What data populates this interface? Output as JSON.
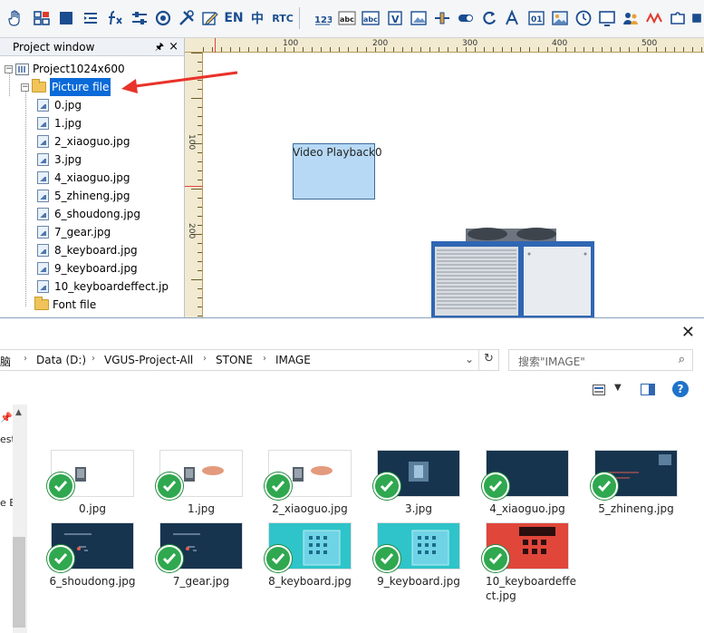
{
  "toolbar": {
    "buttons": [
      {
        "icon": "hand-icon"
      },
      {
        "icon": "grid-icon"
      },
      {
        "icon": "square-icon"
      },
      {
        "icon": "align-icon"
      },
      {
        "icon": "function-icon"
      },
      {
        "icon": "sliders-icon"
      },
      {
        "icon": "circle-arrow-icon"
      },
      {
        "icon": "tools-icon"
      },
      {
        "icon": "edit-icon"
      },
      {
        "label": "EN"
      },
      {
        "label": "中"
      },
      {
        "label": "RTC"
      },
      {
        "icon": "text-123-icon"
      },
      {
        "icon": "text-abc-icon"
      },
      {
        "icon": "text-abc-box-icon"
      },
      {
        "icon": "variable-icon"
      },
      {
        "icon": "image-icon"
      },
      {
        "icon": "slider-icon"
      },
      {
        "icon": "switch-icon"
      },
      {
        "icon": "rotate-icon"
      },
      {
        "icon": "font-icon"
      },
      {
        "icon": "counter-icon"
      },
      {
        "icon": "picture-icon"
      },
      {
        "icon": "clock-icon"
      },
      {
        "icon": "display-icon"
      },
      {
        "icon": "curve-icon"
      },
      {
        "icon": "users-icon"
      },
      {
        "icon": "wave-icon"
      },
      {
        "icon": "puzzle-icon"
      },
      {
        "icon": "chip-icon"
      }
    ],
    "labels": {
      "en": "EN",
      "zh": "中",
      "rtc": "RTC"
    }
  },
  "project_window": {
    "title": "Project window",
    "root": "Project1024x600",
    "picture_folder": "Picture file",
    "files": [
      "0.jpg",
      "1.jpg",
      "2_xiaoguo.jpg",
      "3.jpg",
      "4_xiaoguo.jpg",
      "5_zhineng.jpg",
      "6_shoudong.jpg",
      "7_gear.jpg",
      "8_keyboard.jpg",
      "9_keyboard.jpg",
      "10_keyboardeffect.jp"
    ],
    "font_folder": "Font file"
  },
  "canvas": {
    "ruler_h": [
      "100",
      "200",
      "300",
      "400",
      "500"
    ],
    "ruler_v": [
      "100",
      "200"
    ],
    "widget_label": "Video Playback0"
  },
  "explorer": {
    "breadcrumb": [
      "脑",
      "Data (D:)",
      "VGUS-Project-All",
      "STONE",
      "IMAGE"
    ],
    "search_placeholder": "搜索\"IMAGE\"",
    "side_labels": [
      "estp",
      "e ES"
    ],
    "files": [
      {
        "name": "0.jpg",
        "theme": "white"
      },
      {
        "name": "1.jpg",
        "theme": "white"
      },
      {
        "name": "2_xiaoguo.jpg",
        "theme": "white"
      },
      {
        "name": "3.jpg",
        "theme": "navy"
      },
      {
        "name": "4_xiaoguo.jpg",
        "theme": "navy"
      },
      {
        "name": "5_zhineng.jpg",
        "theme": "navy"
      },
      {
        "name": "6_shoudong.jpg",
        "theme": "navy"
      },
      {
        "name": "7_gear.jpg",
        "theme": "navy"
      },
      {
        "name": "8_keyboard.jpg",
        "theme": "teal"
      },
      {
        "name": "9_keyboard.jpg",
        "theme": "teal"
      },
      {
        "name": "10_keyboardeffect.jpg",
        "theme": "red"
      }
    ],
    "thumb_texts": {
      "intelligent": "Intelligent mode",
      "manual": "Manual mode"
    }
  },
  "colors": {
    "selection": "#0a6ad8",
    "annotation_arrow": "#e8332a",
    "check": "#2fa84f",
    "thumb_navy": "#17344f",
    "thumb_teal": "#2ec4c9",
    "thumb_red": "#e0463a"
  }
}
